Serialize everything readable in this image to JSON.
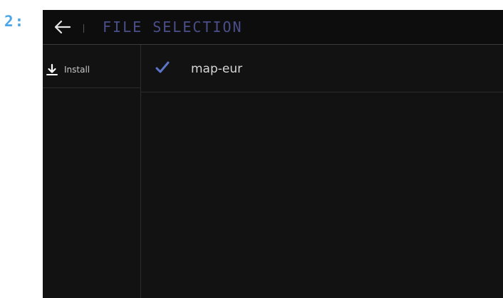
{
  "step": {
    "label": "2:"
  },
  "header": {
    "back_icon": "arrow-left-icon",
    "title": "FILE SELECTION",
    "title_color": "#4a4f8a"
  },
  "sidebar": {
    "items": [
      {
        "label": "Install",
        "icon": "download-icon"
      }
    ]
  },
  "files": [
    {
      "name": "map-eur",
      "checked": true,
      "check_color": "#5c74c8"
    }
  ],
  "colors": {
    "background": "#121212",
    "accent": "#4aa6e6",
    "text": "#d6d6d6"
  }
}
